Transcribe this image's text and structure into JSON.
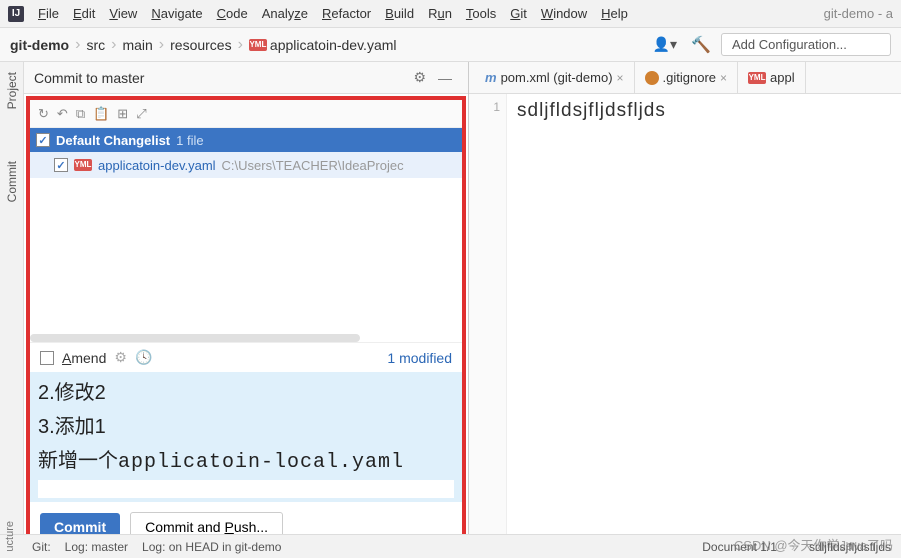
{
  "menu": {
    "items": [
      "File",
      "Edit",
      "View",
      "Navigate",
      "Code",
      "Analyze",
      "Refactor",
      "Build",
      "Run",
      "Tools",
      "Git",
      "Window",
      "Help"
    ]
  },
  "window_title": "git-demo - a",
  "breadcrumb": {
    "project": "git-demo",
    "parts": [
      "src",
      "main",
      "resources"
    ],
    "file": "applicatoin-dev.yaml"
  },
  "run_config_label": "Add Configuration...",
  "commit_panel": {
    "title": "Commit to master",
    "changelist_name": "Default Changelist",
    "changelist_count": "1 file",
    "file_name": "applicatoin-dev.yaml",
    "file_path": "C:\\Users\\TEACHER\\IdeaProjec",
    "amend_label": "Amend",
    "modified_label": "1 modified",
    "message_lines": {
      "l1": "2.修改2",
      "l2": "3.添加1",
      "l3a": "新增一个",
      "l3b": "applicatoin-local.yaml"
    },
    "commit_btn": "Commit",
    "commit_push_btn": "Commit and Push..."
  },
  "tabs": {
    "t1": "pom.xml (git-demo)",
    "t2": ".gitignore",
    "t3": "appl"
  },
  "editor": {
    "line1": "sdljfldsjfljdsfljds"
  },
  "status": {
    "git": "Git:",
    "log_master": "Log: master",
    "log_head": "Log: on HEAD in git-demo",
    "doc": "Document 1/1",
    "word": "sdljfldsjfljdsfljds",
    "ucture": "ucture"
  },
  "side": {
    "project": "Project",
    "commit": "Commit"
  },
  "watermark": "CSDN @今天你学Java了吗"
}
